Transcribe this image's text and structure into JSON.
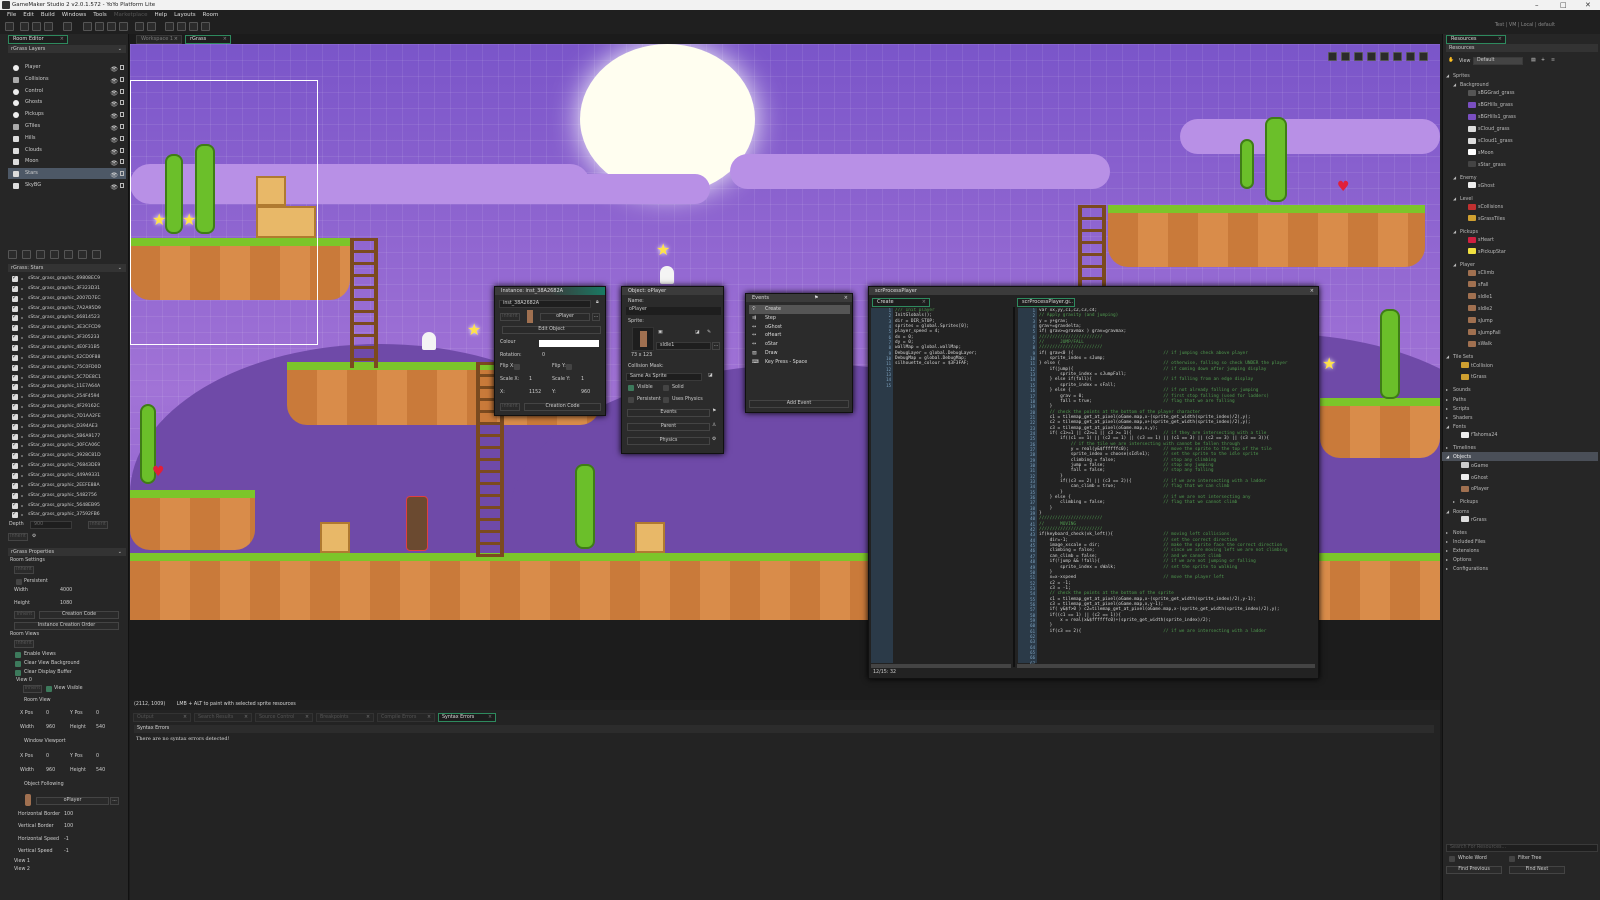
{
  "window": {
    "title": "GameMaker Studio 2  v2.0.1.572 - YoYo Platform Lite",
    "minimize": "–",
    "maximize": "□",
    "close": "✕"
  },
  "menu": [
    "File",
    "Edit",
    "Build",
    "Windows",
    "Tools",
    "Marketplace",
    "Help",
    "Layouts",
    "Room"
  ],
  "menu_disabled": [
    "Marketplace"
  ],
  "target_bar": "Test | VM | Local | default",
  "toolbar_icons": [
    "home-icon",
    "new-file-icon",
    "open-folder-icon",
    "save-icon",
    "package-icon",
    "debug-icon",
    "run-icon",
    "stop-icon",
    "clean-icon",
    "settings-icon",
    "gear-icon",
    "zoom-in-icon",
    "zoom-reset-icon",
    "zoom-out-icon",
    "grid-icon"
  ],
  "left_tab": "Room Editor",
  "workspace_tabs": [
    {
      "label": "Workspace 1",
      "active": false
    },
    {
      "label": "rGrass",
      "active": true
    }
  ],
  "layers": {
    "title": "rGrass Layers",
    "items": [
      {
        "name": "Player",
        "type": "instance"
      },
      {
        "name": "Collisions",
        "type": "tile"
      },
      {
        "name": "Control",
        "type": "instance"
      },
      {
        "name": "Ghosts",
        "type": "instance"
      },
      {
        "name": "Pickups",
        "type": "instance"
      },
      {
        "name": "GTiles",
        "type": "tile"
      },
      {
        "name": "Hills",
        "type": "asset"
      },
      {
        "name": "Clouds",
        "type": "asset"
      },
      {
        "name": "Moon",
        "type": "asset"
      },
      {
        "name": "Stars",
        "type": "asset",
        "selected": true
      },
      {
        "name": "SkyBG",
        "type": "background"
      }
    ]
  },
  "stars_layer": {
    "title": "rGrass: Stars",
    "items": [
      "sStar_grass_graphic_69808EC9",
      "sStar_grass_graphic_3F323D31",
      "sStar_grass_graphic_2007D7EC",
      "sStar_grass_graphic_7A2A95D9",
      "sStar_grass_graphic_66814523",
      "sStar_grass_graphic_3E3CFCD9",
      "sStar_grass_graphic_3F305233",
      "sStar_grass_graphic_4E0F31B5",
      "sStar_grass_graphic_62CD0F88",
      "sStar_grass_graphic_75C0FD0D",
      "sStar_grass_graphic_5C7DE8C1",
      "sStar_grass_graphic_11E7A64A",
      "sStar_grass_graphic_254F4594",
      "sStar_grass_graphic_4F29162C",
      "sStar_grass_graphic_7D1AA2FE",
      "sStar_grass_graphic_D394AE3",
      "sStar_grass_graphic_5B6A9177",
      "sStar_grass_graphic_30FCA06C",
      "sStar_grass_graphic_3928C81D",
      "sStar_grass_graphic_76843DE9",
      "sStar_grass_graphic_449A9331",
      "sStar_grass_graphic_2EEFE88A",
      "sStar_grass_graphic_5482756",
      "sStar_grass_graphic_5648EB95",
      "sStar_grass_graphic_37592FB6"
    ],
    "depth_label": "Depth",
    "depth": "900",
    "inherit": "Inherit"
  },
  "properties": {
    "title": "rGrass Properties",
    "room_settings": "Room Settings",
    "inherit": "Inherit",
    "persistent": "Persistent",
    "width_label": "Width",
    "width": "4000",
    "height_label": "Height",
    "height": "1080",
    "creation_code": "Creation Code",
    "instance_order": "Instance Creation Order",
    "room_views": "Room Views",
    "enable_views": "Enable Views",
    "clear_view_bg": "Clear View Background",
    "clear_display": "Clear Display Buffer",
    "view0": "View 0",
    "view_visible": "View Visible",
    "room_view": "Room View",
    "xpos": "X Pos",
    "ypos": "Y Pos",
    "rv_x": "0",
    "rv_y": "0",
    "rv_w": "960",
    "rv_h": "540",
    "window_viewport": "Window Viewport",
    "wv_x": "0",
    "wv_y": "0",
    "wv_w": "960",
    "wv_h": "540",
    "w_label": "Width",
    "h_label": "Height",
    "object_following": "Object Following",
    "follow_obj": "oPlayer",
    "more": "...",
    "hborder_label": "Horizontal Border",
    "hborder": "100",
    "vborder_label": "Vertical Border",
    "vborder": "100",
    "hspeed_label": "Horizontal Speed",
    "hspeed": "-1",
    "vspeed_label": "Vertical Speed",
    "vspeed": "-1",
    "view1": "View 1",
    "view2": "View 2"
  },
  "room_toolbar_icons": [
    "grid-icon",
    "zoom-out-icon",
    "zoom-in-icon",
    "zoom-reset-icon",
    "fit-icon",
    "snap-icon",
    "play-icon",
    "layer-icon"
  ],
  "instance_window": {
    "title": "Instance: inst_38A2682A",
    "name": "inst_38A2682A",
    "inherit": "Inherit",
    "object": "oPlayer",
    "more": "...",
    "edit_object": "Edit Object",
    "colour_label": "Colour",
    "colour": "#ffffff",
    "rotation_label": "Rotation:",
    "rotation": "0",
    "flipx": "Flip X:",
    "flipy": "Flip Y:",
    "scalex_label": "Scale X:",
    "scalex": "1",
    "scaley_label": "Scale Y:",
    "scaley": "1",
    "x_label": "X:",
    "x": "1152",
    "y_label": "Y:",
    "y": "960",
    "creation_code": "Creation Code"
  },
  "object_window": {
    "title": "Object: oPlayer",
    "name_label": "Name:",
    "name": "oPlayer",
    "sprite_label": "Sprite:",
    "sprite": "sIdle1",
    "size": "73 x 123",
    "more": "...",
    "mask_label": "Collision Mask:",
    "mask": "Same As Sprite",
    "visible": "Visible",
    "solid": "Solid",
    "persistent": "Persistent",
    "physics": "Uses Physics",
    "events": "Events",
    "parent": "Parent",
    "physics_btn": "Physics"
  },
  "events_window": {
    "title": "Events",
    "items": [
      {
        "label": "Create",
        "icon": "lightbulb-icon",
        "selected": true
      },
      {
        "label": "Step",
        "icon": "footsteps-icon"
      },
      {
        "label": "oGhost",
        "icon": "collision-icon"
      },
      {
        "label": "oHeart",
        "icon": "collision-icon"
      },
      {
        "label": "oStar",
        "icon": "collision-icon"
      },
      {
        "label": "Draw",
        "icon": "draw-icon"
      },
      {
        "label": "Key Press - Space",
        "icon": "keyboard-icon"
      }
    ],
    "add_event": "Add Event"
  },
  "code_window": {
    "title": "scrProcessPlayer",
    "left_tab": "Create",
    "right_tab": "scrProcessPlayer.g...",
    "status": "12/15: 32",
    "create_code": [
      "/// Init player",
      "",
      "InitGlobals();",
      "",
      "dir = DIR_STOP;",
      "sprites = global.Sprites[0];",
      "player_speed = 4;",
      "dx = 0;",
      "dy = 0;",
      "",
      "wallMap = global.wallMap;",
      "DebugLayer = global.DebugLayer;",
      "DebugMap = global.DebugMap;",
      "",
      "silhouette_colour = $3F3FAF;"
    ],
    "script_code": [
      "var xx,yy,c1,c2,c3,c4;",
      "",
      "// Apply gravity (and jumping)",
      "y = y+grav;",
      "grav+=gravdelta;",
      "if( grav>=gravmax ) grav=gravmax;",
      "",
      "////////////////////////",
      "//      JUMP/FALL",
      "////////////////////////",
      "",
      "if( grav<0 ){                                  // if jumping check above player",
      "    sprite_index = sJump;",
      "} else {                                       // otherwise, falling so check UNDER the player",
      "    if(jump){                                  // if coming down after jumping display",
      "        sprite_index = sJumpFall;",
      "    } else if(fall){                           // if falling from an edge display",
      "        sprite_index = sFall;",
      "    } else {                                   // if not already falling or jumping",
      "        grav = 0;                              // first stop falling (used for ladders)",
      "        fall = true;                           // flag that we are falling",
      "    }",
      "    // check the points at the bottom of the player character",
      "    c1 = tilemap_get_at_pixel(oGame.map,x-(sprite_get_width(sprite_index)/2),y);",
      "    c2 = tilemap_get_at_pixel(oGame.map,x+(sprite_get_width(sprite_index)/2),y);",
      "    c3 = tilemap_get_at_pixel(oGame.map,x,y);",
      "",
      "    if( c1>=1 || c2>=1 || c3 >= 1){            // if they are intersecting with a tile",
      "        if((c1 == 1) || (c2 == 1) || (c3 == 1) || (c1 == 3) || (c2 == 3) || (c3 == 3)){",
      "            // if the tile we are intersecting with cannot be fallen through",
      "            y = real(y&$ffffffc0);             // move the sprite to the top of the tile",
      "            sprite_index = choose(sIdle1);     // set the sprite to the idle sprite",
      "            climbing = false;                  // stop any climbing",
      "            jump = false;                      // stop any jumping",
      "            fall = false;                      // stop any falling",
      "        }",
      "        if((c3 == 2) || (c3 == 2)){            // if we are intersecting with a ladder",
      "            can_climb = true;                  // flag that we can climb",
      "        }",
      "    } else {                                   // if we are not intersecting any",
      "        climbing = false;                      // flag that we cannot climb",
      "    }",
      "}",
      "",
      "////////////////////////",
      "//      MOVING",
      "////////////////////////",
      "",
      "if(keyboard_check(vk_left)){                   // moving left collisions",
      "    dir=-1;                                    // set the correct direction",
      "    image_xscale = dir;                        // make the sprite face the correct direction",
      "    climbing = false;                          // since we are moving left we are not climbing",
      "    can_climb = false;                         // and we cannot climb",
      "    if(!jump && !fall){                        // if we are not jumping or falling",
      "        sprite_index = sWalk;                  // set the sprite to walking",
      "    }",
      "    x=x-xspeed                                 // move the player left",
      "    c2 = -1;",
      "    c3 = -1;",
      "    // check the points at the bottom of the sprite",
      "    c1 = tilemap_get_at_pixel(oGame.map,x-(sprite_get_width(sprite_index)/2),y-1);",
      "    c3 = tilemap_get_at_pixel(oGame.map,x,y-1);",
      "    if( y&$f>0 ) c2=tilemap_get_at_pixel(oGame.map,x-(sprite_get_width(sprite_index)/2),y);",
      "    if((c1 == 1) || (c2 == 1)){",
      "        x = real(x&$ffffffc0)+(sprite_get_width(sprite_index)/2);",
      "    }",
      "    if(c3 == 2){                               // if we are intersecting with a ladder"
    ]
  },
  "status_bar": {
    "coords": "(2112, 1009)",
    "hint": "LMB + ALT to paint with selected sprite resources"
  },
  "output": {
    "tabs": [
      {
        "label": "Output",
        "active": false
      },
      {
        "label": "Search Results",
        "active": false
      },
      {
        "label": "Source Control",
        "active": false
      },
      {
        "label": "Breakpoints",
        "active": false
      },
      {
        "label": "Compile Errors",
        "active": false
      },
      {
        "label": "Syntax Errors",
        "active": true
      }
    ],
    "panel_title": "Syntax Errors",
    "message": "There are no syntax errors detected!"
  },
  "resources": {
    "tab": "Resources",
    "header": "Resources",
    "view_label": "View",
    "view_value": "Default",
    "search_placeholder": "Search For Resources...",
    "whole_word": "Whole Word",
    "filter_tree": "Filter Tree",
    "find_previous": "Find Previous",
    "find_next": "Find Next",
    "tree": [
      {
        "label": "Sprites",
        "depth": 0,
        "folder": true,
        "open": true
      },
      {
        "label": "Background",
        "depth": 1,
        "folder": true,
        "open": true
      },
      {
        "label": "sBGGrad_grass",
        "depth": 2,
        "color": "#555555"
      },
      {
        "label": "sBGHills_grass",
        "depth": 2,
        "color": "#7a4fc0"
      },
      {
        "label": "sBGHills1_grass",
        "depth": 2,
        "color": "#7a4fc0"
      },
      {
        "label": "sCloud_grass",
        "depth": 2,
        "color": "#dddddd"
      },
      {
        "label": "sCloud1_grass",
        "depth": 2,
        "color": "#dddddd"
      },
      {
        "label": "sMoon",
        "depth": 2,
        "color": "#ffffff"
      },
      {
        "label": "sStar_grass",
        "depth": 2,
        "color": "#444444"
      },
      {
        "label": "Enemy",
        "depth": 1,
        "folder": true,
        "open": true
      },
      {
        "label": "sGhost",
        "depth": 2,
        "color": "#eeeeee"
      },
      {
        "label": "Level",
        "depth": 1,
        "folder": true,
        "open": true
      },
      {
        "label": "sCollisions",
        "depth": 2,
        "color": "#c03030"
      },
      {
        "label": "sGrassTiles",
        "depth": 2,
        "color": "#d0a030"
      },
      {
        "label": "Pickups",
        "depth": 1,
        "folder": true,
        "open": true
      },
      {
        "label": "sHeart",
        "depth": 2,
        "color": "#d02040"
      },
      {
        "label": "sPickupStar",
        "depth": 2,
        "color": "#f0e040"
      },
      {
        "label": "Player",
        "depth": 1,
        "folder": true,
        "open": true
      },
      {
        "label": "sClimb",
        "depth": 2,
        "color": "#a07050"
      },
      {
        "label": "sFall",
        "depth": 2,
        "color": "#a07050"
      },
      {
        "label": "sIdle1",
        "depth": 2,
        "color": "#a07050"
      },
      {
        "label": "sIdle2",
        "depth": 2,
        "color": "#a07050"
      },
      {
        "label": "sJump",
        "depth": 2,
        "color": "#a07050"
      },
      {
        "label": "sJumpFall",
        "depth": 2,
        "color": "#a07050"
      },
      {
        "label": "sWalk",
        "depth": 2,
        "color": "#a07050"
      },
      {
        "label": "Tile Sets",
        "depth": 0,
        "folder": true,
        "open": true
      },
      {
        "label": "tCollision",
        "depth": 1,
        "color": "#d0a030"
      },
      {
        "label": "tGrass",
        "depth": 1,
        "color": "#d0a030"
      },
      {
        "label": "Sounds",
        "depth": 0,
        "folder": true
      },
      {
        "label": "Paths",
        "depth": 0,
        "folder": true
      },
      {
        "label": "Scripts",
        "depth": 0,
        "folder": true
      },
      {
        "label": "Shaders",
        "depth": 0,
        "folder": true
      },
      {
        "label": "Fonts",
        "depth": 0,
        "folder": true,
        "open": true
      },
      {
        "label": "fTahoma24",
        "depth": 1,
        "color": "#eeeeee"
      },
      {
        "label": "Timelines",
        "depth": 0,
        "folder": true
      },
      {
        "label": "Objects",
        "depth": 0,
        "folder": true,
        "open": true,
        "selected": true
      },
      {
        "label": "oGame",
        "depth": 1,
        "color": "#cccccc"
      },
      {
        "label": "oGhost",
        "depth": 1,
        "color": "#eeeeee"
      },
      {
        "label": "oPlayer",
        "depth": 1,
        "color": "#a07050"
      },
      {
        "label": "Pickups",
        "depth": 1,
        "folder": true
      },
      {
        "label": "Rooms",
        "depth": 0,
        "folder": true,
        "open": true
      },
      {
        "label": "rGrass",
        "depth": 1,
        "color": "#dddddd"
      },
      {
        "label": "Notes",
        "depth": 0,
        "folder": true
      },
      {
        "label": "Included Files",
        "depth": 0,
        "folder": true
      },
      {
        "label": "Extensions",
        "depth": 0,
        "folder": true
      },
      {
        "label": "Options",
        "depth": 0,
        "folder": true
      },
      {
        "label": "Configurations",
        "depth": 0,
        "folder": true
      }
    ]
  },
  "colors": {
    "accent": "#2e8a5e",
    "room_bg": "#8f63d0",
    "selection": "#4d5866"
  }
}
